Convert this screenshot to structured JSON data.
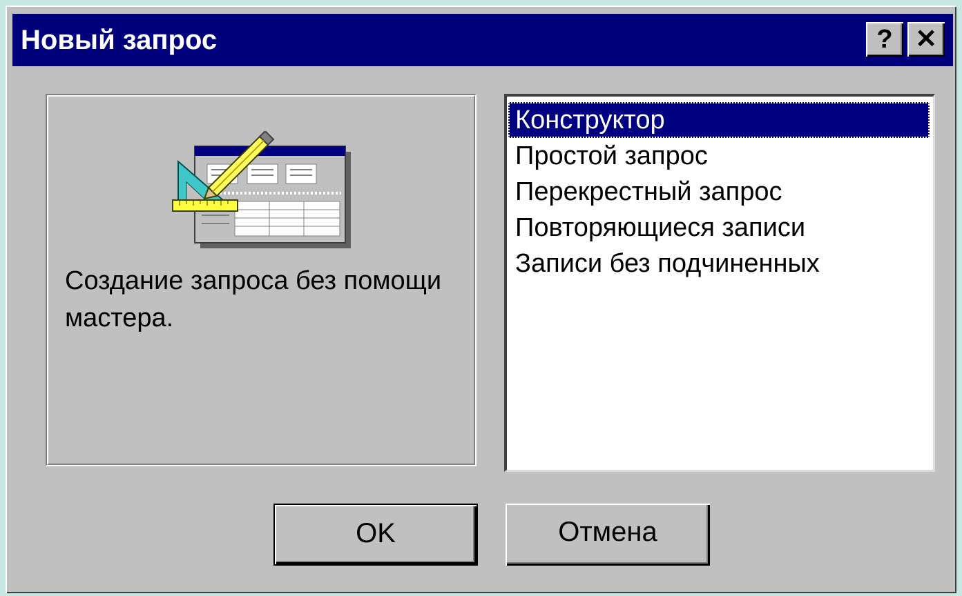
{
  "window": {
    "title": "Новый запрос",
    "help_label": "?",
    "close_label": "✕"
  },
  "preview": {
    "description": "Создание запроса без помощи мастера."
  },
  "query_types": [
    {
      "label": "Конструктор",
      "selected": true
    },
    {
      "label": "Простой запрос",
      "selected": false
    },
    {
      "label": "Перекрестный запрос",
      "selected": false
    },
    {
      "label": "Повторяющиеся записи",
      "selected": false
    },
    {
      "label": "Записи без подчиненных",
      "selected": false
    }
  ],
  "buttons": {
    "ok_label": "OK",
    "cancel_label": "Отмена"
  },
  "colors": {
    "titlebar": "#00007a",
    "face": "#c0c0c0",
    "desktop": "#c6e6e2",
    "selection": "#000080"
  }
}
